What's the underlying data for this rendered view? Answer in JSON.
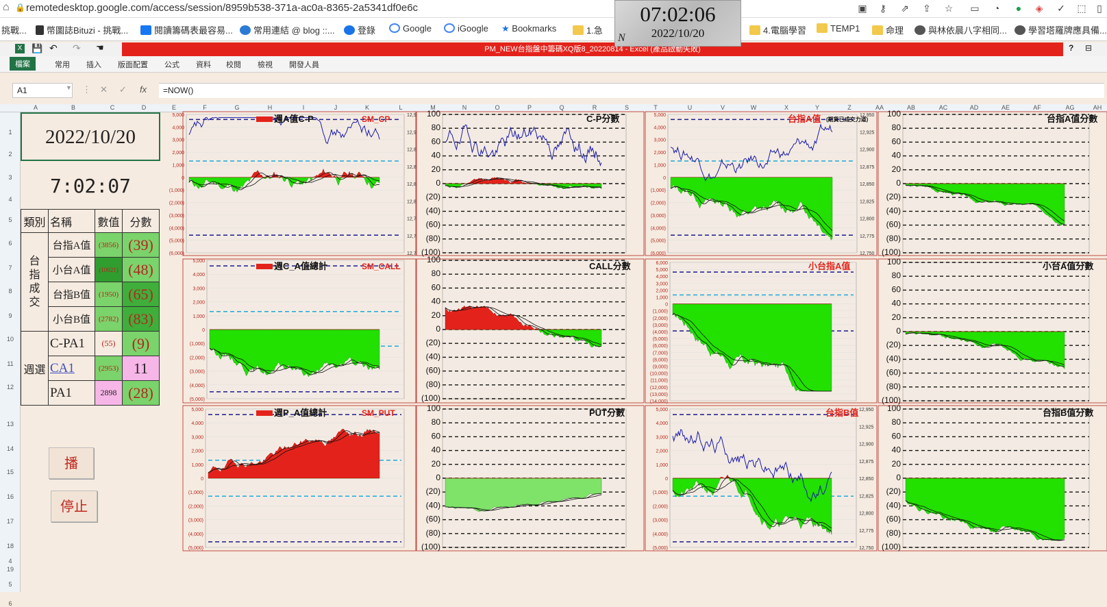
{
  "browser": {
    "url": "remotedesktop.google.com/access/session/8959b538-371a-ac0a-8365-2a5341df0e6c",
    "bookmarks": [
      "挑戰...",
      "幣圖誌Bituzi - 挑戰...",
      "閱讀籌碼表最容易...",
      "常用連結 @ blog ::...",
      "登錄",
      "Google",
      "iGoogle",
      "Bookmarks",
      "1.急",
      "4.電腦學習",
      "TEMP1",
      "命理",
      "與林依晨八字相同...",
      "學習塔羅牌應具備..."
    ]
  },
  "overlay_clock": {
    "time": "07:02:06",
    "date": "2022/10/20",
    "corner": "N"
  },
  "excel": {
    "title": "PM_NEW台指盤中籌碼XQ版8_20220814 - Excel (產品啟動失敗)",
    "tabs": [
      "檔案",
      "常用",
      "插入",
      "版面配置",
      "公式",
      "資料",
      "校閱",
      "檢視",
      "開發人員"
    ],
    "name_box": "A1",
    "formula": "=NOW()",
    "columns": [
      "A",
      "B",
      "C",
      "D",
      "E",
      "F",
      "G",
      "H",
      "I",
      "J",
      "K",
      "L",
      "M",
      "N",
      "O",
      "P",
      "Q",
      "R",
      "S",
      "T",
      "U",
      "V",
      "W",
      "X",
      "Y",
      "Z",
      "AA",
      "AB",
      "AC",
      "AD",
      "AE",
      "AF",
      "AG",
      "AH"
    ],
    "rows": [
      "1",
      "2",
      "3",
      "4",
      "5",
      "6",
      "7",
      "8",
      "9",
      "10",
      "11",
      "12",
      "13",
      "14",
      "15",
      "16",
      "17",
      "18",
      "19",
      "4",
      "5",
      "6"
    ]
  },
  "panel": {
    "date": "2022/10/20",
    "time": "7:02:07",
    "headers": [
      "類別",
      "名稱",
      "數值",
      "分數"
    ],
    "group1_label": "台指成交",
    "group2_label": "週選",
    "rows": [
      {
        "name": "台指A值",
        "value": "(3856)",
        "score": "(39)"
      },
      {
        "name": "小台A值",
        "value": "(10021)",
        "score": "(48)"
      },
      {
        "name": "台指B值",
        "value": "(1950)",
        "score": "(65)"
      },
      {
        "name": "小台B值",
        "value": "(2782)",
        "score": "(83)"
      },
      {
        "name": "C-PA1",
        "value": "(55)",
        "score": "(9)"
      },
      {
        "name": "CA1",
        "value": "(2953)",
        "score": "11"
      },
      {
        "name": "PA1",
        "value": "2898",
        "score": "(28)"
      }
    ],
    "play_button": "播",
    "stop_button": "停止"
  },
  "charts": {
    "cp": {
      "title": "週A值C-P",
      "sm": "SM_CP"
    },
    "cp_score": {
      "title": "C-P分數"
    },
    "taizhi_a": {
      "title": "台指A值",
      "note": "(期貨已成交力道)"
    },
    "taizhi_a_score": {
      "title": "台指A值分數"
    },
    "call": {
      "title": "週C_A值總計",
      "sm": "SM_CALL"
    },
    "call_score": {
      "title": "CALL分數"
    },
    "xiaotai_a": {
      "title": "小台指A值"
    },
    "xiaotai_a_score": {
      "title": "小台A值分數"
    },
    "put": {
      "title": "週P_A值總計",
      "sm": "SM_PUT"
    },
    "put_score": {
      "title": "PUT分數"
    },
    "taizhi_b": {
      "title": "台指B值"
    },
    "taizhi_b_score": {
      "title": "台指B值分數"
    }
  },
  "chart_data": [
    {
      "type": "area",
      "name": "cp",
      "ylim": [
        -6000,
        5000
      ],
      "y2lim": [
        12740,
        12940
      ]
    },
    {
      "type": "area",
      "name": "cp_score",
      "ylim": [
        -100,
        100
      ]
    },
    {
      "type": "area",
      "name": "taizhi_a",
      "ylim": [
        -6000,
        5000
      ],
      "y2lim": [
        12750,
        12950
      ]
    },
    {
      "type": "area",
      "name": "taizhi_a_score",
      "ylim": [
        -100,
        100
      ]
    },
    {
      "type": "area",
      "name": "call",
      "ylim": [
        -5000,
        5000
      ]
    },
    {
      "type": "area",
      "name": "call_score",
      "ylim": [
        -100,
        100
      ]
    },
    {
      "type": "area",
      "name": "xiaotai_a",
      "ylim": [
        -14000,
        6000
      ]
    },
    {
      "type": "area",
      "name": "xiaotai_a_score",
      "ylim": [
        -100,
        100
      ]
    },
    {
      "type": "area",
      "name": "put",
      "ylim": [
        -5000,
        5000
      ]
    },
    {
      "type": "area",
      "name": "put_score",
      "ylim": [
        -100,
        100
      ]
    },
    {
      "type": "area",
      "name": "taizhi_b",
      "ylim": [
        -5000,
        5000
      ],
      "y2lim": [
        12750,
        12950
      ]
    },
    {
      "type": "area",
      "name": "taizhi_b_score",
      "ylim": [
        -100,
        100
      ]
    }
  ]
}
